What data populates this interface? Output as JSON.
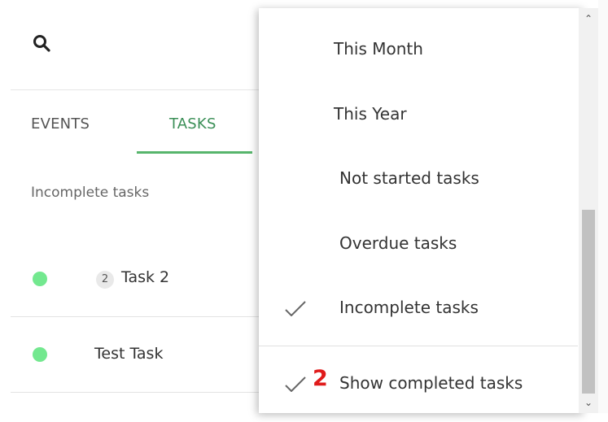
{
  "tabs": [
    {
      "label": "EVENTS"
    },
    {
      "label": "TASKS"
    }
  ],
  "section_label": "Incomplete tasks",
  "tasks": [
    {
      "count": "2",
      "title": "Task 2",
      "status_color": "#73e88f"
    },
    {
      "title": "Test Task",
      "status_color": "#73e88f"
    }
  ],
  "menu": {
    "items": [
      {
        "label": "This Month",
        "checked": false
      },
      {
        "label": "This Year",
        "checked": false
      },
      {
        "label": "Not started tasks",
        "checked": false
      },
      {
        "label": "Overdue tasks",
        "checked": false
      },
      {
        "label": "Incomplete tasks",
        "checked": true
      },
      {
        "label": "Show completed tasks",
        "checked": true
      }
    ],
    "annotation_number": "2"
  },
  "colors": {
    "accent": "#57b56c",
    "annotation": "#e01b1b"
  },
  "icons": {
    "search": "search-icon",
    "check": "check-icon",
    "scroll_up": "chevron-up-icon",
    "scroll_down": "chevron-down-icon"
  }
}
